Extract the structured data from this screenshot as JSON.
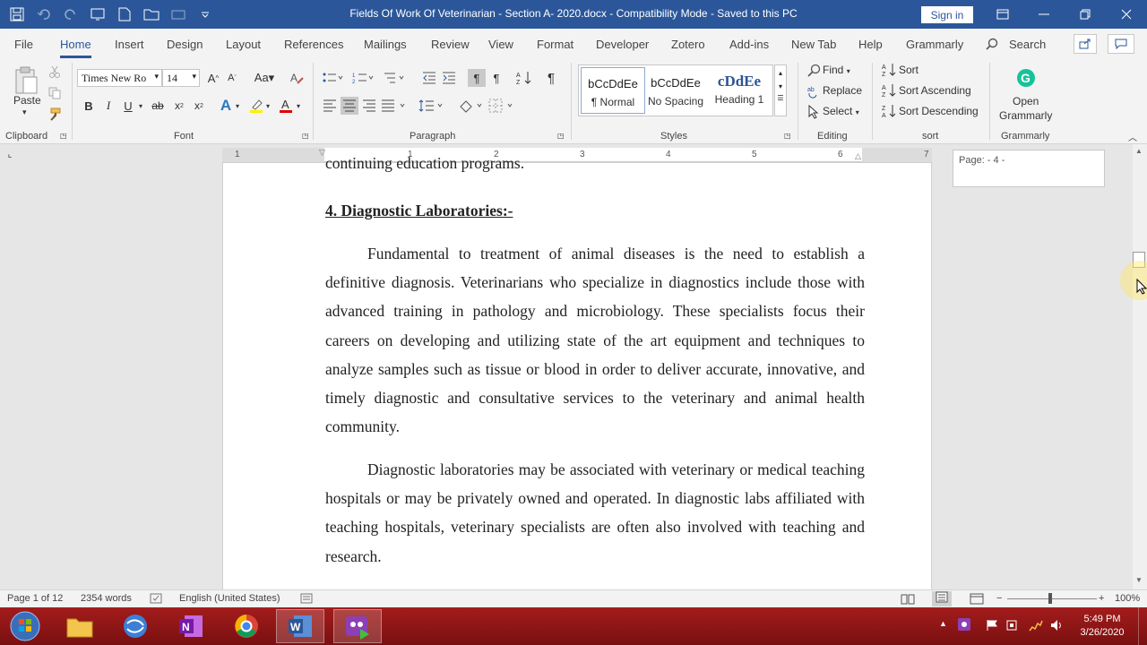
{
  "window": {
    "title": "Fields Of Work Of Veterinarian - Section A- 2020.docx  -  Compatibility Mode  -  Saved to this PC",
    "sign_in": "Sign in"
  },
  "tabs": [
    "File",
    "Home",
    "Insert",
    "Design",
    "Layout",
    "References",
    "Mailings",
    "Review",
    "View",
    "Format",
    "Developer",
    "Zotero",
    "Add-ins",
    "New Tab",
    "Help",
    "Grammarly"
  ],
  "search": {
    "label": "Search"
  },
  "ribbon": {
    "clipboard": {
      "paste": "Paste",
      "group": "Clipboard"
    },
    "font": {
      "name": "Times New Ro",
      "size": "14",
      "group": "Font"
    },
    "paragraph": {
      "group": "Paragraph"
    },
    "styles": {
      "group": "Styles",
      "items": [
        {
          "sample": "bCcDdEe",
          "name": "¶ Normal"
        },
        {
          "sample": "bCcDdEe",
          "name": "No Spacing"
        },
        {
          "sample": "cDdEe",
          "name": "Heading 1"
        }
      ]
    },
    "editing": {
      "group": "Editing",
      "find": "Find",
      "replace": "Replace",
      "select": "Select"
    },
    "sort": {
      "group": "sort",
      "sort": "Sort",
      "asc": "Sort Ascending",
      "desc": "Sort Descending"
    },
    "grammarly": {
      "group": "Grammarly",
      "open": "Open",
      "grammarly": "Grammarly"
    }
  },
  "ruler_numbers": [
    "1",
    "1",
    "2",
    "3",
    "4",
    "5",
    "6",
    "7"
  ],
  "document": {
    "prev_line": "continuing education programs.",
    "heading": "4. Diagnostic Laboratories:-",
    "para1": "Fundamental to treatment of animal diseases is the need to establish a definitive diagnosis. Veterinarians who specialize in diagnostics include those with advanced training in pathology and microbiology. These specialists focus their careers on developing and utilizing state of the art equipment and techniques to analyze samples such as tissue or blood in order to deliver accurate, innovative, and timely diagnostic and consultative services to the veterinary and animal health community.",
    "para2": "Diagnostic laboratories may be associated with veterinary or medical teaching hospitals or may be privately owned and operated. In diagnostic labs affiliated with teaching hospitals, veterinary specialists are often also involved with teaching and research."
  },
  "page_tip": "Page: - 4 -",
  "status": {
    "page": "Page 1 of 12",
    "words": "2354 words",
    "language": "English (United States)",
    "zoom": "100%"
  },
  "clock": {
    "time": "5:49 PM",
    "date": "3/26/2020"
  }
}
